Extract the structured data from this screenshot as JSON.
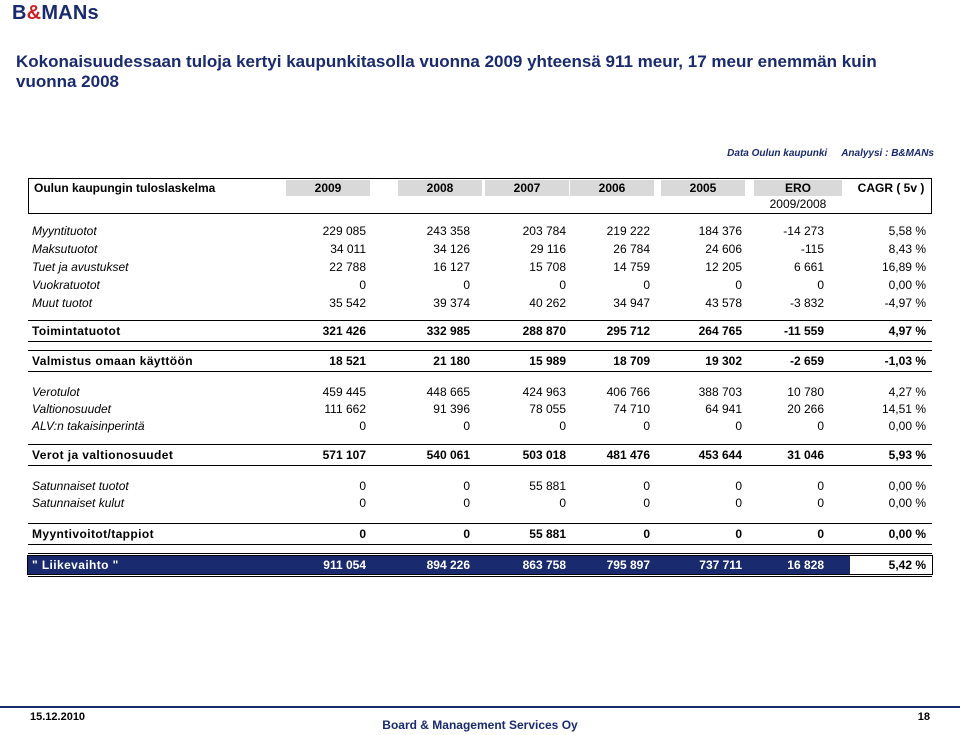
{
  "brand": {
    "part1": "B",
    "amp": "&",
    "part2": "MANs"
  },
  "title": "Kokonaisuudessaan tuloja kertyi kaupunkitasolla vuonna 2009 yhteensä 911 meur,  17 meur enemmän kuin vuonna 2008",
  "meta": {
    "source": "Data Oulun kaupunki",
    "analysis": "Analyysi : B&MANs"
  },
  "table": {
    "name": "Oulun kaupungin tuloslaskelma",
    "columns": [
      "2009",
      "2008",
      "2007",
      "2006",
      "2005",
      "ERO",
      "CAGR ( 5v )"
    ],
    "ero_sub": "2009/2008",
    "rows": [
      {
        "label": "Myyntituotot",
        "values": [
          "229 085",
          "243 358",
          "203 784",
          "219 222",
          "184 376",
          "-14 273",
          "5,58 %"
        ]
      },
      {
        "label": "Maksutuotot",
        "values": [
          "34 011",
          "34 126",
          "29 116",
          "26 784",
          "24 606",
          "-115",
          "8,43 %"
        ]
      },
      {
        "label": "Tuet ja avustukset",
        "values": [
          "22 788",
          "16 127",
          "15 708",
          "14 759",
          "12 205",
          "6 661",
          "16,89 %"
        ]
      },
      {
        "label": "Vuokratuotot",
        "values": [
          "0",
          "0",
          "0",
          "0",
          "0",
          "0",
          "0,00 %"
        ]
      },
      {
        "label": "Muut tuotot",
        "values": [
          "35 542",
          "39 374",
          "40 262",
          "34 947",
          "43 578",
          "-3 832",
          "-4,97 %"
        ]
      },
      {
        "label": "Toimintatuotot",
        "values": [
          "321 426",
          "332 985",
          "288 870",
          "295 712",
          "264 765",
          "-11 559",
          "4,97 %"
        ]
      },
      {
        "label": "Valmistus omaan käyttöön",
        "values": [
          "18 521",
          "21 180",
          "15 989",
          "18 709",
          "19 302",
          "-2 659",
          "-1,03 %"
        ]
      },
      {
        "label": "Verotulot",
        "values": [
          "459 445",
          "448 665",
          "424 963",
          "406 766",
          "388 703",
          "10 780",
          "4,27 %"
        ]
      },
      {
        "label": "Valtionosuudet",
        "values": [
          "111 662",
          "91 396",
          "78 055",
          "74 710",
          "64 941",
          "20 266",
          "14,51 %"
        ]
      },
      {
        "label": "ALV:n takaisinperintä",
        "values": [
          "0",
          "0",
          "0",
          "0",
          "0",
          "0",
          "0,00 %"
        ]
      },
      {
        "label": "Verot ja valtionosuudet",
        "values": [
          "571 107",
          "540 061",
          "503 018",
          "481 476",
          "453 644",
          "31 046",
          "5,93 %"
        ]
      },
      {
        "label": "Satunnaiset tuotot",
        "values": [
          "0",
          "0",
          "55 881",
          "0",
          "0",
          "0",
          "0,00 %"
        ]
      },
      {
        "label": "Satunnaiset kulut",
        "values": [
          "0",
          "0",
          "0",
          "0",
          "0",
          "0",
          "0,00 %"
        ]
      },
      {
        "label": "Myyntivoitot/tappiot",
        "values": [
          "0",
          "0",
          "55 881",
          "0",
          "0",
          "0",
          "0,00 %"
        ]
      },
      {
        "label": "\" Liikevaihto \"",
        "values": [
          "911 054",
          "894 226",
          "863 758",
          "795 897",
          "737 711",
          "16 828",
          "5,42 %"
        ]
      }
    ]
  },
  "footer": {
    "date": "15.12.2010",
    "company": "Board & Management Services Oy",
    "page": "18"
  }
}
